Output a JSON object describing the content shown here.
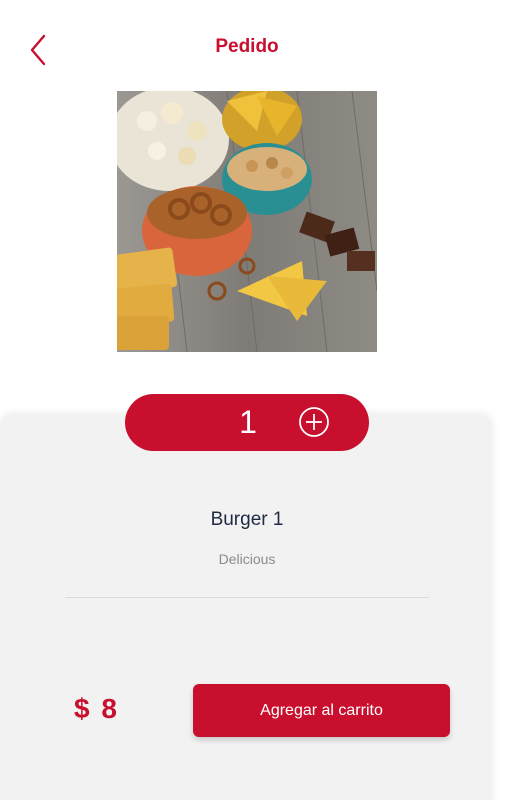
{
  "header": {
    "title": "Pedido"
  },
  "product": {
    "image_description_icon": "snacks-photo",
    "quantity": "1",
    "name": "Burger 1",
    "description": "Delicious",
    "price": "$ 8",
    "add_to_cart_label": "Agregar al carrito"
  },
  "colors": {
    "accent": "#c8102e",
    "card_background": "#f2f2f2",
    "product_name": "#1f2a44",
    "description": "#8a8a8a"
  }
}
